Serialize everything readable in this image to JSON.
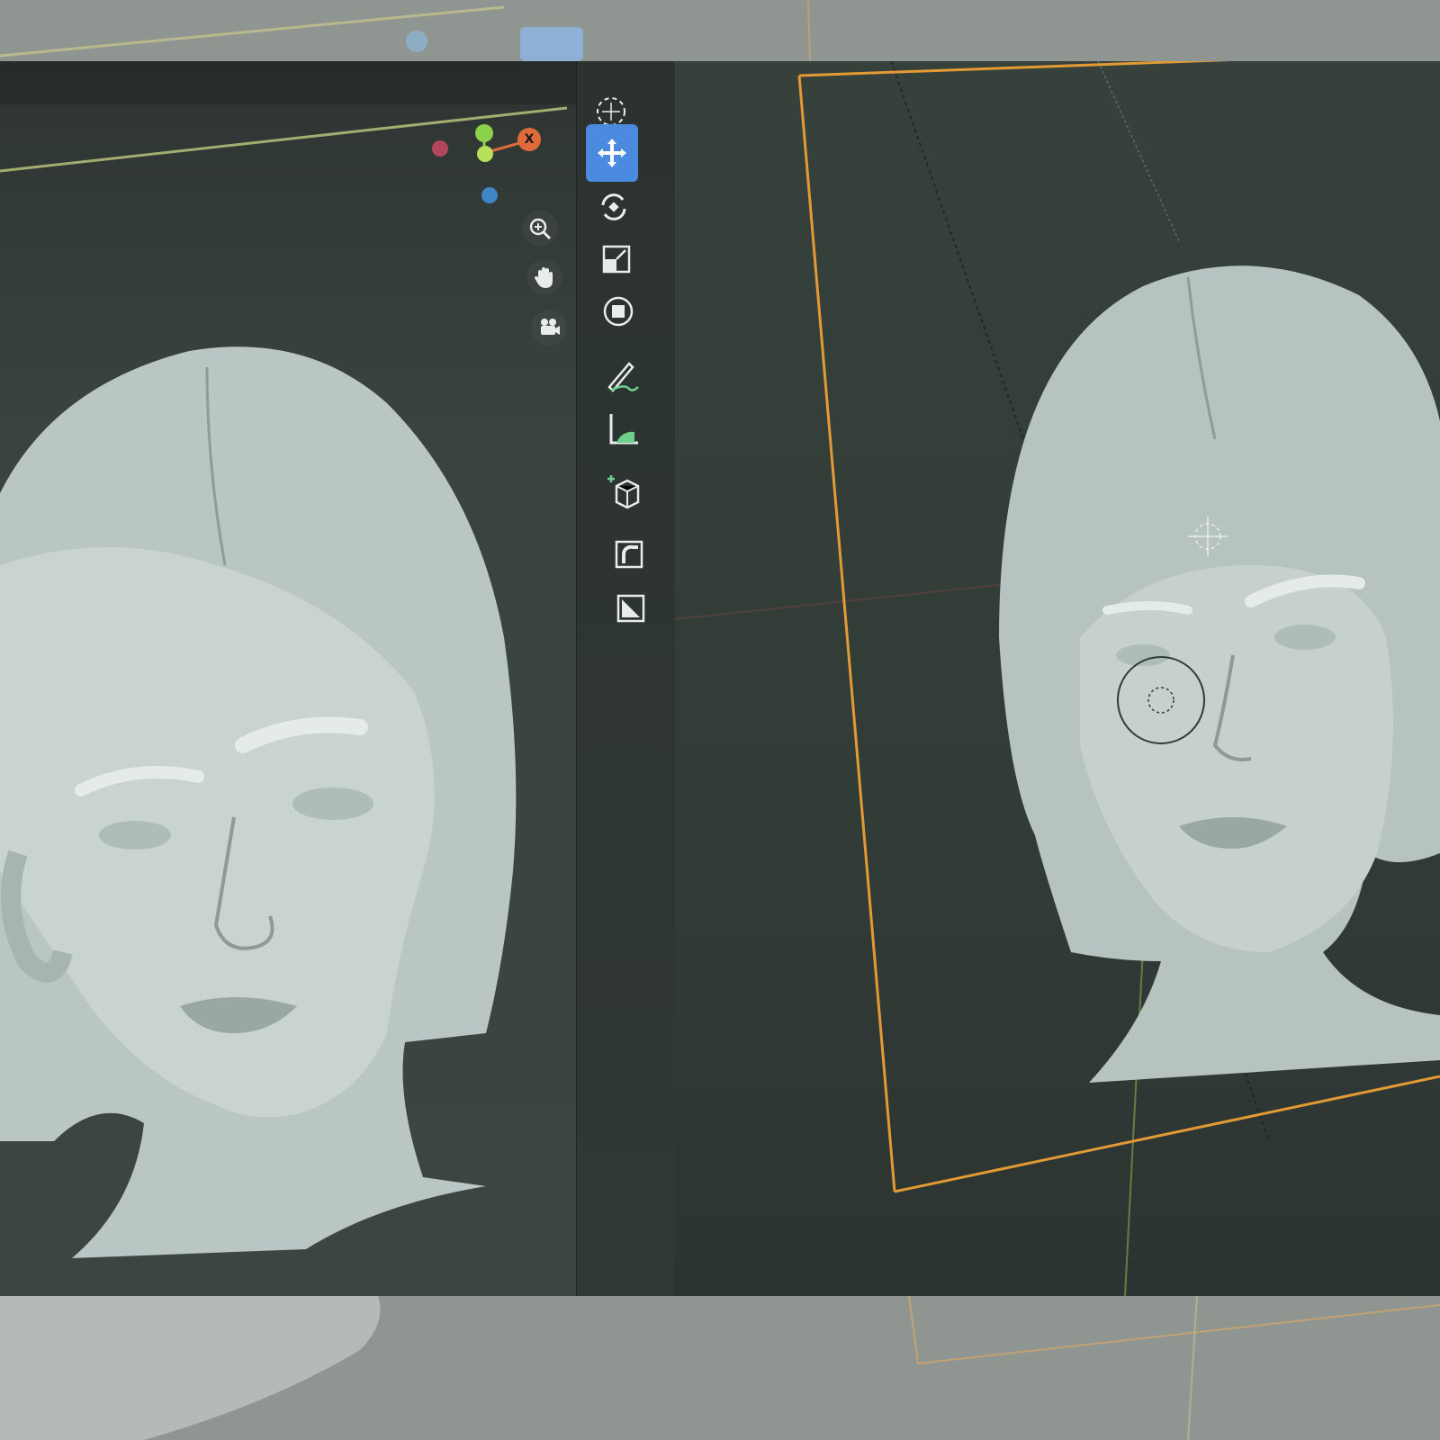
{
  "app": {
    "accent": "#4a8be0",
    "frame_color": "#e39a35"
  },
  "gizmo": {
    "x_axis_label": "X",
    "x_color": "#e06a3a",
    "y_color": "#8bd14a",
    "z_color": "#3e86c6",
    "neg_x_color": "#b2455a"
  },
  "navigation": {
    "items": [
      {
        "name": "zoom",
        "icon": "zoom-icon"
      },
      {
        "name": "pan",
        "icon": "hand-icon"
      },
      {
        "name": "camera",
        "icon": "camera-icon"
      }
    ]
  },
  "toolbar": {
    "tools": [
      {
        "name": "cursor",
        "icon": "cursor-icon",
        "active": false
      },
      {
        "name": "move",
        "icon": "move-icon",
        "active": true
      },
      {
        "name": "rotate",
        "icon": "rotate-icon",
        "active": false
      },
      {
        "name": "scale",
        "icon": "scale-icon",
        "active": false
      },
      {
        "name": "transform",
        "icon": "transform-icon",
        "active": false
      },
      {
        "name": "annotate",
        "icon": "annotate-icon",
        "active": false
      },
      {
        "name": "measure",
        "icon": "measure-icon",
        "active": false
      },
      {
        "name": "add-cube",
        "icon": "add-cube-icon",
        "active": false
      },
      {
        "name": "extrude",
        "icon": "extrude-icon",
        "active": false
      },
      {
        "name": "inset",
        "icon": "inset-icon",
        "active": false
      }
    ]
  },
  "viewports": {
    "left": {
      "subject": "sculpted-head-model"
    },
    "right": {
      "subject": "sculpted-head-model"
    }
  }
}
